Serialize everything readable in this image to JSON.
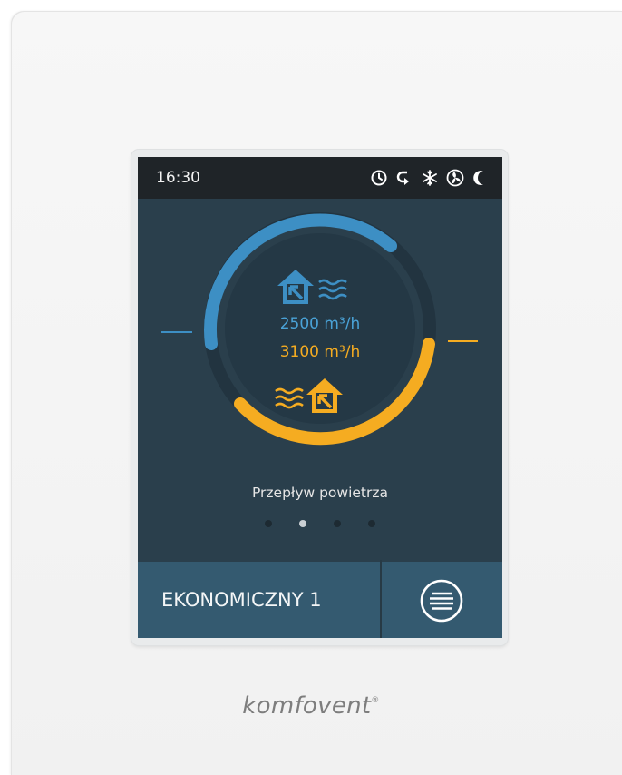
{
  "status_bar": {
    "time": "16:30",
    "icons": [
      "clock-icon",
      "return-arrow-icon",
      "snowflake-icon",
      "fan-icon",
      "moon-icon"
    ]
  },
  "dial": {
    "supply_flow": "2500 m³/h",
    "extract_flow": "3100 m³/h",
    "supply_color": "#3d8fc4",
    "extract_color": "#f5ac21",
    "supply_icon": "supply-air-house-icon",
    "extract_icon": "extract-air-house-icon"
  },
  "caption": "Przepływ powietrza",
  "pagination": {
    "pages": 4,
    "active": 2
  },
  "mode_button": {
    "label": "EKONOMICZNY 1"
  },
  "menu_button": {
    "icon": "menu-icon"
  },
  "brand": {
    "name": "komfovent",
    "mark": "®"
  }
}
